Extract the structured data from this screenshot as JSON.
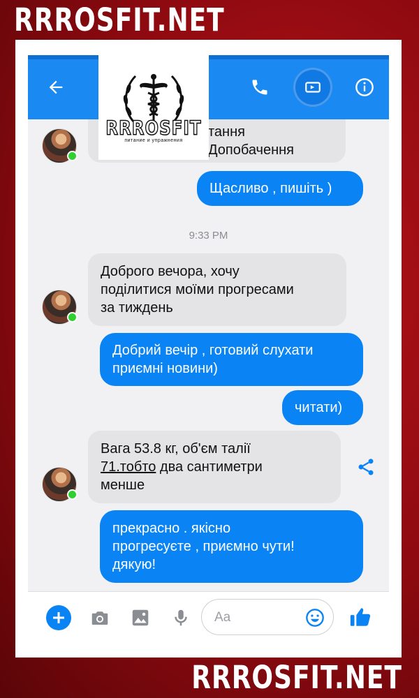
{
  "watermark": {
    "top": "RRROSFIT.NET",
    "bottom": "RRROSFIT.NET"
  },
  "logo": {
    "name": "RRROSFIT",
    "tagline": "питание и упражнения"
  },
  "colors": {
    "accent": "#0a84f5",
    "header": "#1a8af2",
    "online": "#2fd02f",
    "background": "#9e0d13"
  },
  "header": {
    "icons": {
      "back": "back-arrow-icon",
      "call": "phone-icon",
      "video": "video-camera-icon",
      "info": "info-icon"
    }
  },
  "conversation": {
    "partial_in_line1": "тання",
    "partial_in_line2": "Допобачення",
    "out1": "Щасливо , пишіть )",
    "timestamp": "9:33 PM",
    "in2": [
      "Доброго вечора, хочу",
      "поділитися моїми прогресами",
      "за тиждень"
    ],
    "out2": [
      "Добрий вечір , готовий слухати",
      "приємні новини)"
    ],
    "out3": "читати)",
    "in3": [
      "Вага 53.8 кг, об'єм талії",
      "71.тобто",
      " два сантиметри",
      "менше"
    ],
    "out4": [
      "прекрасно . якісно",
      "прогресуєте , приємно чути!",
      "дякую!"
    ]
  },
  "composer": {
    "placeholder": "Aa",
    "icons": [
      "plus-icon",
      "camera-icon",
      "image-icon",
      "microphone-icon",
      "emoji-icon",
      "thumbs-up-icon"
    ]
  }
}
